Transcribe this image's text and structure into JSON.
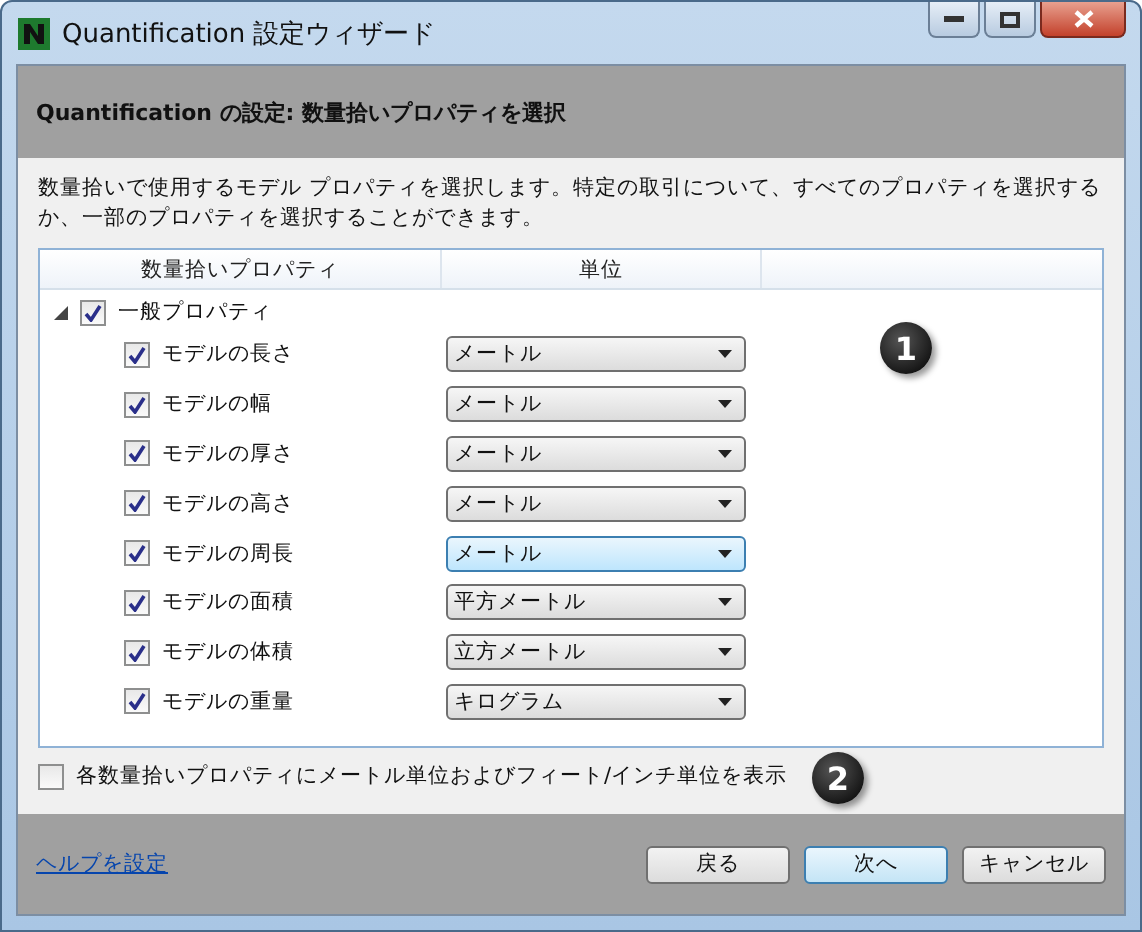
{
  "window": {
    "title": "Quantification 設定ウィザード"
  },
  "header": {
    "title": "Quantification の設定: 数量拾いプロパティを選択"
  },
  "description": "数量拾いで使用するモデル プロパティを選択します。特定の取引について、すべてのプロパティを選択するか、一部のプロパティを選択することができます。",
  "table": {
    "columns": [
      "数量拾いプロパティ",
      "単位"
    ],
    "groups": [
      {
        "name": "一般プロパティ",
        "expanded": true,
        "checked": true,
        "children": [
          {
            "name": "モデルの長さ",
            "checked": true,
            "unit": "メートル",
            "focused": false
          },
          {
            "name": "モデルの幅",
            "checked": true,
            "unit": "メートル",
            "focused": false
          },
          {
            "name": "モデルの厚さ",
            "checked": true,
            "unit": "メートル",
            "focused": false
          },
          {
            "name": "モデルの高さ",
            "checked": true,
            "unit": "メートル",
            "focused": false
          },
          {
            "name": "モデルの周長",
            "checked": true,
            "unit": "メートル",
            "focused": true
          },
          {
            "name": "モデルの面積",
            "checked": true,
            "unit": "平方メートル",
            "focused": false
          },
          {
            "name": "モデルの体積",
            "checked": true,
            "unit": "立方メートル",
            "focused": false
          },
          {
            "name": "モデルの重量",
            "checked": true,
            "unit": "キログラム",
            "focused": false
          }
        ]
      }
    ]
  },
  "option": {
    "label": "各数量拾いプロパティにメートル単位およびフィート/インチ単位を表示",
    "checked": false
  },
  "callouts": [
    "1",
    "2"
  ],
  "footer": {
    "help_link": "ヘルプを設定",
    "buttons": [
      {
        "label": "戻る",
        "default": false
      },
      {
        "label": "次へ",
        "default": true
      },
      {
        "label": "キャンセル",
        "default": false
      }
    ]
  }
}
